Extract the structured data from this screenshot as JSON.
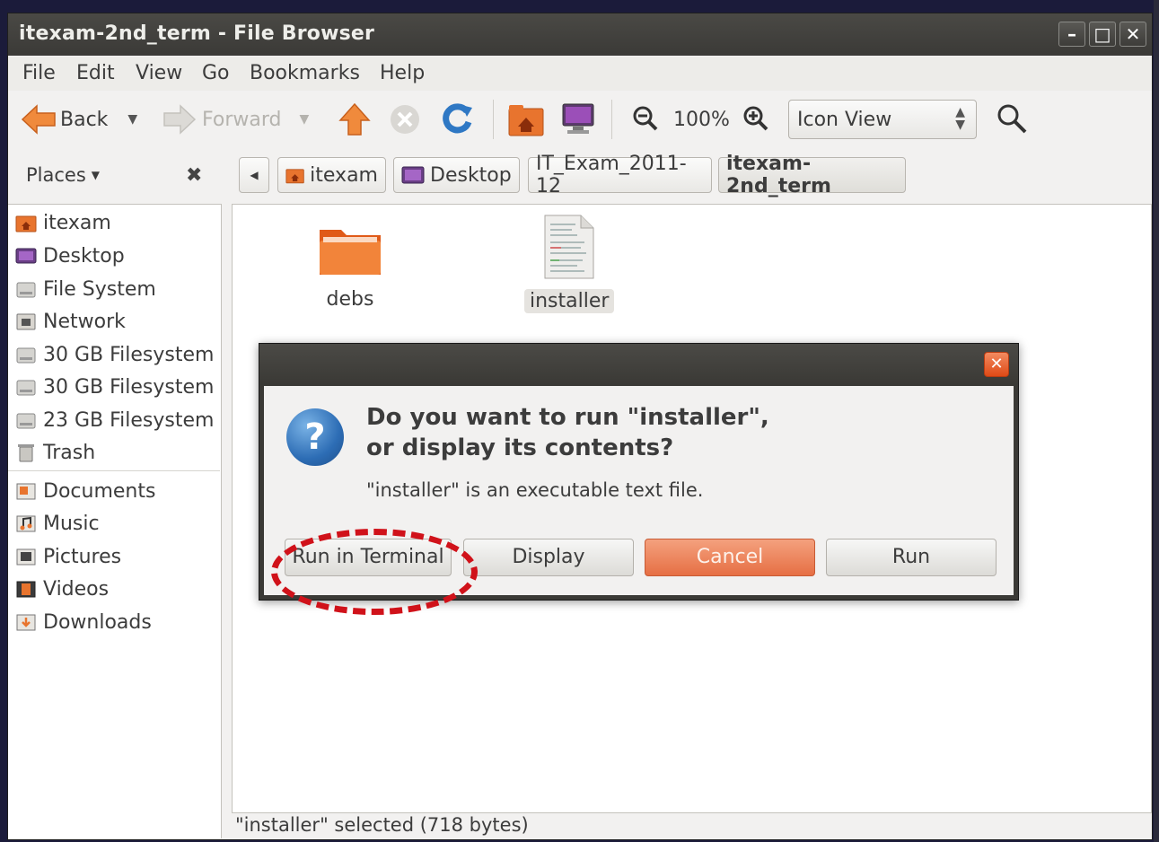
{
  "window": {
    "title": "itexam-2nd_term - File Browser",
    "controls": [
      "minimize-icon",
      "maximize-icon",
      "close-icon"
    ]
  },
  "menu": {
    "file": "File",
    "edit": "Edit",
    "view": "View",
    "go": "Go",
    "bookmarks": "Bookmarks",
    "help": "Help"
  },
  "toolbar": {
    "back": "Back",
    "forward": "Forward",
    "zoom_level": "100%",
    "view_mode": "Icon View"
  },
  "location": {
    "places_label": "Places",
    "crumbs": [
      "itexam",
      "Desktop",
      "IT_Exam_2011-12",
      "itexam-2nd_term"
    ]
  },
  "sidebar": {
    "items": [
      {
        "label": "itexam",
        "icon": "home-folder-icon"
      },
      {
        "label": "Desktop",
        "icon": "desktop-icon"
      },
      {
        "label": "File System",
        "icon": "drive-icon"
      },
      {
        "label": "Network",
        "icon": "network-icon"
      },
      {
        "label": "30 GB Filesystem",
        "icon": "drive-icon"
      },
      {
        "label": "30 GB Filesystem",
        "icon": "drive-icon"
      },
      {
        "label": "23 GB Filesystem",
        "icon": "drive-icon"
      },
      {
        "label": "Trash",
        "icon": "trash-icon"
      }
    ],
    "bookmarks": [
      {
        "label": "Documents",
        "icon": "documents-icon"
      },
      {
        "label": "Music",
        "icon": "music-icon"
      },
      {
        "label": "Pictures",
        "icon": "pictures-icon"
      },
      {
        "label": "Videos",
        "icon": "videos-icon"
      },
      {
        "label": "Downloads",
        "icon": "downloads-icon"
      }
    ]
  },
  "files": [
    {
      "name": "debs",
      "icon": "folder-icon",
      "selected": false
    },
    {
      "name": "installer",
      "icon": "text-file-icon",
      "selected": true
    }
  ],
  "dialog": {
    "primary_line1": "Do you want to run \"installer\",",
    "primary_line2": "or display its contents?",
    "secondary": "\"installer\" is an executable text file.",
    "buttons": {
      "run_in_terminal": "Run in Terminal",
      "display": "Display",
      "cancel": "Cancel",
      "run": "Run"
    }
  },
  "status": {
    "text": "\"installer\" selected (718 bytes)"
  },
  "colors": {
    "accent": "#e66f44",
    "annotation": "#d0121a",
    "titlebar": "#3c3b37"
  }
}
